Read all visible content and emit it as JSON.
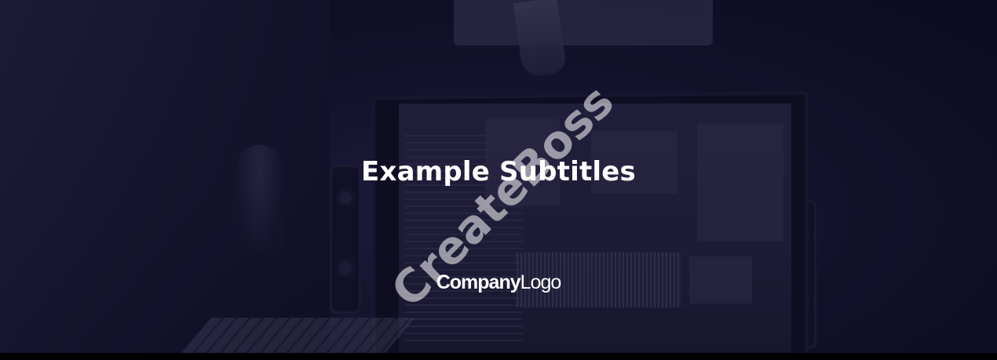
{
  "title": "Example Subtitles",
  "logo": {
    "strong": "Company",
    "light": "Logo"
  },
  "watermark": "CreateBoss",
  "colors": {
    "overlay": "#17162e",
    "text": "#ffffff",
    "bottom_bar": "#000000"
  }
}
